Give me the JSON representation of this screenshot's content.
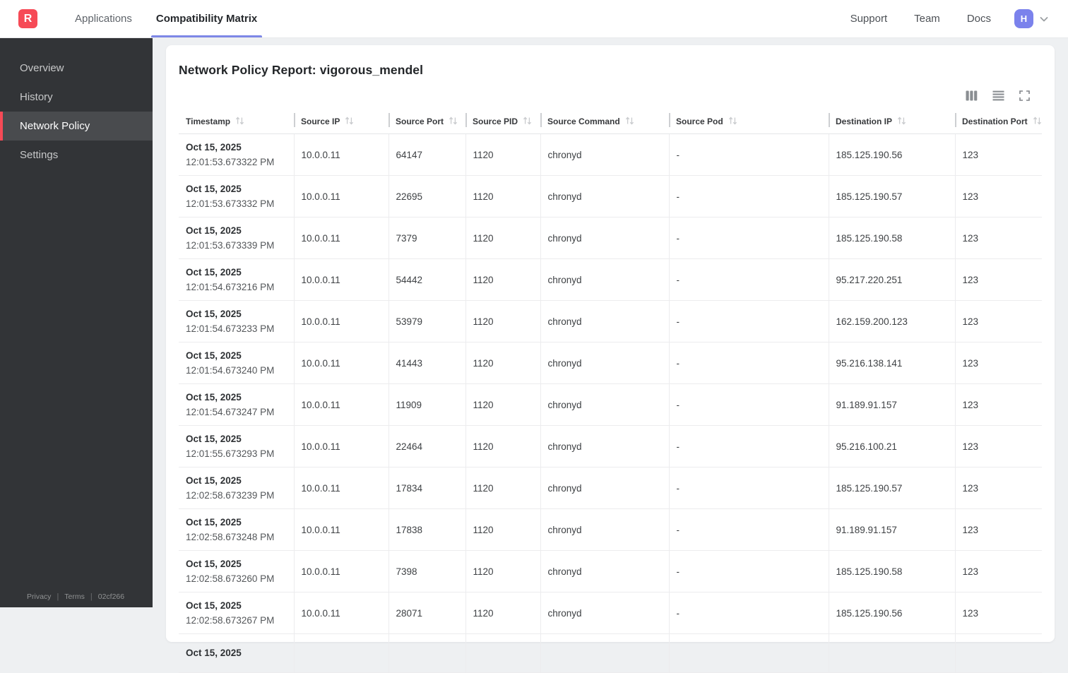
{
  "topnav": {
    "logo_letter": "R",
    "tabs": [
      {
        "label": "Applications",
        "active": false
      },
      {
        "label": "Compatibility Matrix",
        "active": true
      }
    ],
    "right_links": [
      "Support",
      "Team",
      "Docs"
    ],
    "avatar_letter": "H",
    "icons": [
      "chevron-down-icon"
    ]
  },
  "sidebar": {
    "items": [
      {
        "label": "Overview",
        "active": false
      },
      {
        "label": "History",
        "active": false
      },
      {
        "label": "Network Policy",
        "active": true
      },
      {
        "label": "Settings",
        "active": false
      }
    ],
    "footer_links": [
      "Privacy",
      "Terms",
      "02cf266"
    ]
  },
  "report": {
    "title": "Network Policy Report: vigorous_mendel",
    "toolbar_icons": [
      "columns-view-icon",
      "list-view-icon",
      "fullscreen-icon"
    ],
    "table": {
      "columns": [
        "Timestamp",
        "Source IP",
        "Source Port",
        "Source PID",
        "Source Command",
        "Source Pod",
        "Destination IP",
        "Destination Port"
      ],
      "sort_icon": "up-down-arrows",
      "rows": [
        {
          "date": "Oct 15, 2025",
          "time": "12:01:53.673322 PM",
          "source_ip": "10.0.0.11",
          "source_port": "64147",
          "source_pid": "1120",
          "source_command": "chronyd",
          "source_pod": "-",
          "dest_ip": "185.125.190.56",
          "dest_port": "123"
        },
        {
          "date": "Oct 15, 2025",
          "time": "12:01:53.673332 PM",
          "source_ip": "10.0.0.11",
          "source_port": "22695",
          "source_pid": "1120",
          "source_command": "chronyd",
          "source_pod": "-",
          "dest_ip": "185.125.190.57",
          "dest_port": "123"
        },
        {
          "date": "Oct 15, 2025",
          "time": "12:01:53.673339 PM",
          "source_ip": "10.0.0.11",
          "source_port": "7379",
          "source_pid": "1120",
          "source_command": "chronyd",
          "source_pod": "-",
          "dest_ip": "185.125.190.58",
          "dest_port": "123"
        },
        {
          "date": "Oct 15, 2025",
          "time": "12:01:54.673216 PM",
          "source_ip": "10.0.0.11",
          "source_port": "54442",
          "source_pid": "1120",
          "source_command": "chronyd",
          "source_pod": "-",
          "dest_ip": "95.217.220.251",
          "dest_port": "123"
        },
        {
          "date": "Oct 15, 2025",
          "time": "12:01:54.673233 PM",
          "source_ip": "10.0.0.11",
          "source_port": "53979",
          "source_pid": "1120",
          "source_command": "chronyd",
          "source_pod": "-",
          "dest_ip": "162.159.200.123",
          "dest_port": "123"
        },
        {
          "date": "Oct 15, 2025",
          "time": "12:01:54.673240 PM",
          "source_ip": "10.0.0.11",
          "source_port": "41443",
          "source_pid": "1120",
          "source_command": "chronyd",
          "source_pod": "-",
          "dest_ip": "95.216.138.141",
          "dest_port": "123"
        },
        {
          "date": "Oct 15, 2025",
          "time": "12:01:54.673247 PM",
          "source_ip": "10.0.0.11",
          "source_port": "11909",
          "source_pid": "1120",
          "source_command": "chronyd",
          "source_pod": "-",
          "dest_ip": "91.189.91.157",
          "dest_port": "123"
        },
        {
          "date": "Oct 15, 2025",
          "time": "12:01:55.673293 PM",
          "source_ip": "10.0.0.11",
          "source_port": "22464",
          "source_pid": "1120",
          "source_command": "chronyd",
          "source_pod": "-",
          "dest_ip": "95.216.100.21",
          "dest_port": "123"
        },
        {
          "date": "Oct 15, 2025",
          "time": "12:02:58.673239 PM",
          "source_ip": "10.0.0.11",
          "source_port": "17834",
          "source_pid": "1120",
          "source_command": "chronyd",
          "source_pod": "-",
          "dest_ip": "185.125.190.57",
          "dest_port": "123"
        },
        {
          "date": "Oct 15, 2025",
          "time": "12:02:58.673248 PM",
          "source_ip": "10.0.0.11",
          "source_port": "17838",
          "source_pid": "1120",
          "source_command": "chronyd",
          "source_pod": "-",
          "dest_ip": "91.189.91.157",
          "dest_port": "123"
        },
        {
          "date": "Oct 15, 2025",
          "time": "12:02:58.673260 PM",
          "source_ip": "10.0.0.11",
          "source_port": "7398",
          "source_pid": "1120",
          "source_command": "chronyd",
          "source_pod": "-",
          "dest_ip": "185.125.190.58",
          "dest_port": "123"
        },
        {
          "date": "Oct 15, 2025",
          "time": "12:02:58.673267 PM",
          "source_ip": "10.0.0.11",
          "source_port": "28071",
          "source_pid": "1120",
          "source_command": "chronyd",
          "source_pod": "-",
          "dest_ip": "185.125.190.56",
          "dest_port": "123"
        },
        {
          "date": "Oct 15, 2025",
          "time": "",
          "source_ip": "",
          "source_port": "",
          "source_pid": "",
          "source_command": "",
          "source_pod": "",
          "dest_ip": "",
          "dest_port": ""
        }
      ]
    }
  },
  "colors": {
    "brand_red": "#f64a56",
    "accent_indigo": "#7e87e6",
    "avatar_purple": "#7b82ec",
    "sidebar_bg": "#323437",
    "sidebar_active_bg": "#494b4e",
    "page_bg": "#eef0f2"
  }
}
